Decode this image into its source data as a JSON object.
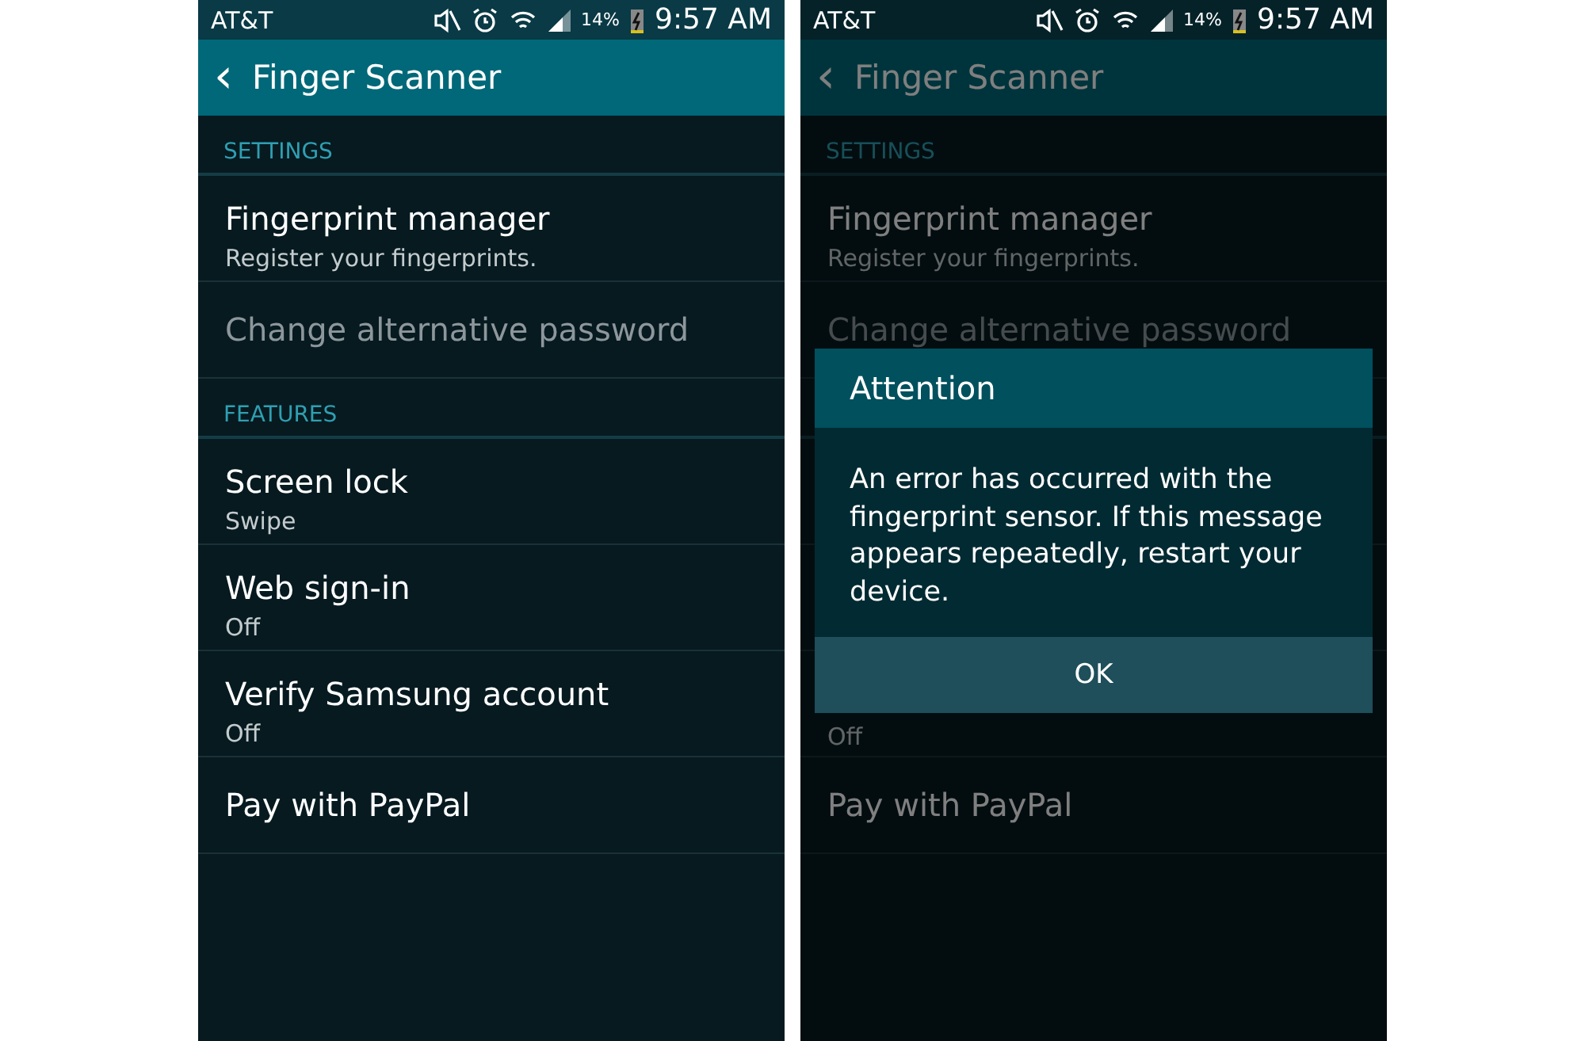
{
  "screens": [
    {
      "dimmed": false,
      "status_bar": {
        "carrier": "AT&T",
        "battery": "14%",
        "time": "9:57 AM"
      },
      "toolbar": {
        "back": "‹",
        "title": "Finger Scanner"
      },
      "sections": [
        {
          "header": "SETTINGS",
          "items": [
            {
              "kind": "two-line",
              "title": "Fingerprint manager",
              "subtitle": "Register your fingerprints.",
              "disabled": false
            },
            {
              "kind": "one-line",
              "title": "Change alternative password",
              "disabled": true
            }
          ]
        },
        {
          "header": "FEATURES",
          "items": [
            {
              "kind": "two-line",
              "title": "Screen lock",
              "subtitle": "Swipe",
              "disabled": false
            },
            {
              "kind": "two-line",
              "title": "Web sign-in",
              "subtitle": "Off",
              "disabled": false
            },
            {
              "kind": "two-line",
              "title": "Verify Samsung account",
              "subtitle": "Off",
              "disabled": false
            },
            {
              "kind": "one-line",
              "title": "Pay with PayPal",
              "disabled": false
            }
          ]
        }
      ]
    },
    {
      "dimmed": true,
      "status_bar": {
        "carrier": "AT&T",
        "battery": "14%",
        "time": "9:57 AM"
      },
      "toolbar": {
        "back": "‹",
        "title": "Finger Scanner"
      },
      "sections": [
        {
          "header": "SETTINGS",
          "items": [
            {
              "kind": "two-line",
              "title": "Fingerprint manager",
              "subtitle": "Register your fingerprints.",
              "disabled": false
            },
            {
              "kind": "one-line",
              "title": "Change alternative password",
              "disabled": true
            }
          ]
        },
        {
          "items": [
            {
              "kind": "two-line"
            },
            {
              "kind": "two-line"
            },
            {
              "kind": "two-line",
              "subtitle": "Off"
            },
            {
              "kind": "one-line",
              "title": "Pay with PayPal",
              "disabled": false
            }
          ]
        }
      ],
      "dialog": {
        "title": "Attention",
        "message": "An error has occurred with the fingerprint sensor. If this message appears repeatedly, restart your device.",
        "button": "OK"
      }
    }
  ]
}
